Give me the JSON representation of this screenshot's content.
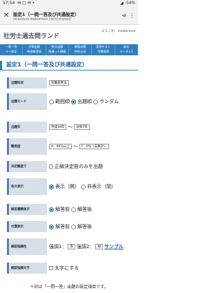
{
  "status": {
    "time": "17:54",
    "battery": "54%"
  },
  "browser": {
    "title": "設定1（一問一答及び共通設定）",
    "url": "sharousi-kakomon.com/myset/"
  },
  "site": {
    "logo": "社労士過去問ランド",
    "welcome": "ようこそ！ msaibcenor"
  },
  "nav": {
    "top": [
      "一問一答",
      "付箋出題",
      "肢点出題",
      "模擬出題",
      "実践テスト",
      "設定"
    ],
    "sub": [
      "マイ設定",
      "単語帳登録",
      "間違った問題",
      "特別企画",
      "付箋管理",
      "ランダム1"
    ]
  },
  "section_title": "設定1（一問一答及び共通設定）",
  "rows": {
    "subject": {
      "label": "出題科目",
      "value": "労働基準法"
    },
    "mode": {
      "label": "出題モード",
      "opt1": "範囲順",
      "opt2": "出題順",
      "opt3": "ランダム"
    },
    "year": {
      "label": "出題年",
      "from": "平成16年",
      "sep": "〜",
      "to": "令和7年"
    },
    "difficulty": {
      "label": "難易度",
      "from": "A：90％以上",
      "sep": "〜",
      "to": "F：0％（未集計）"
    },
    "correct_setting": {
      "label": "決定難度で",
      "value": "正解決定肢のみを出題"
    },
    "statement": {
      "label": "条文表示",
      "opt1": "表示（開）",
      "opt2": "非表示（閉）"
    },
    "answer_display": {
      "label": "解答種類表示",
      "opt1": "解答前",
      "opt2": "解答後"
    },
    "sticky": {
      "label": "付箋表示",
      "opt1": "解答前",
      "opt2": "解答後"
    },
    "highlight": {
      "label": "解説強調色",
      "emph1": "強調1：",
      "c1": "赤",
      "emph2": "強調2：",
      "c2": "緑",
      "sample": "サンプル"
    },
    "bold": {
      "label": "解説強調文字",
      "value": "太字にする"
    }
  },
  "footer": {
    "mark": "＊",
    "text": "印は「一問一答」出題の設定項目です。"
  },
  "colors": {
    "accent": "#2f7fbf",
    "label_bg": "#d7dfe8",
    "red": "#c00000"
  }
}
